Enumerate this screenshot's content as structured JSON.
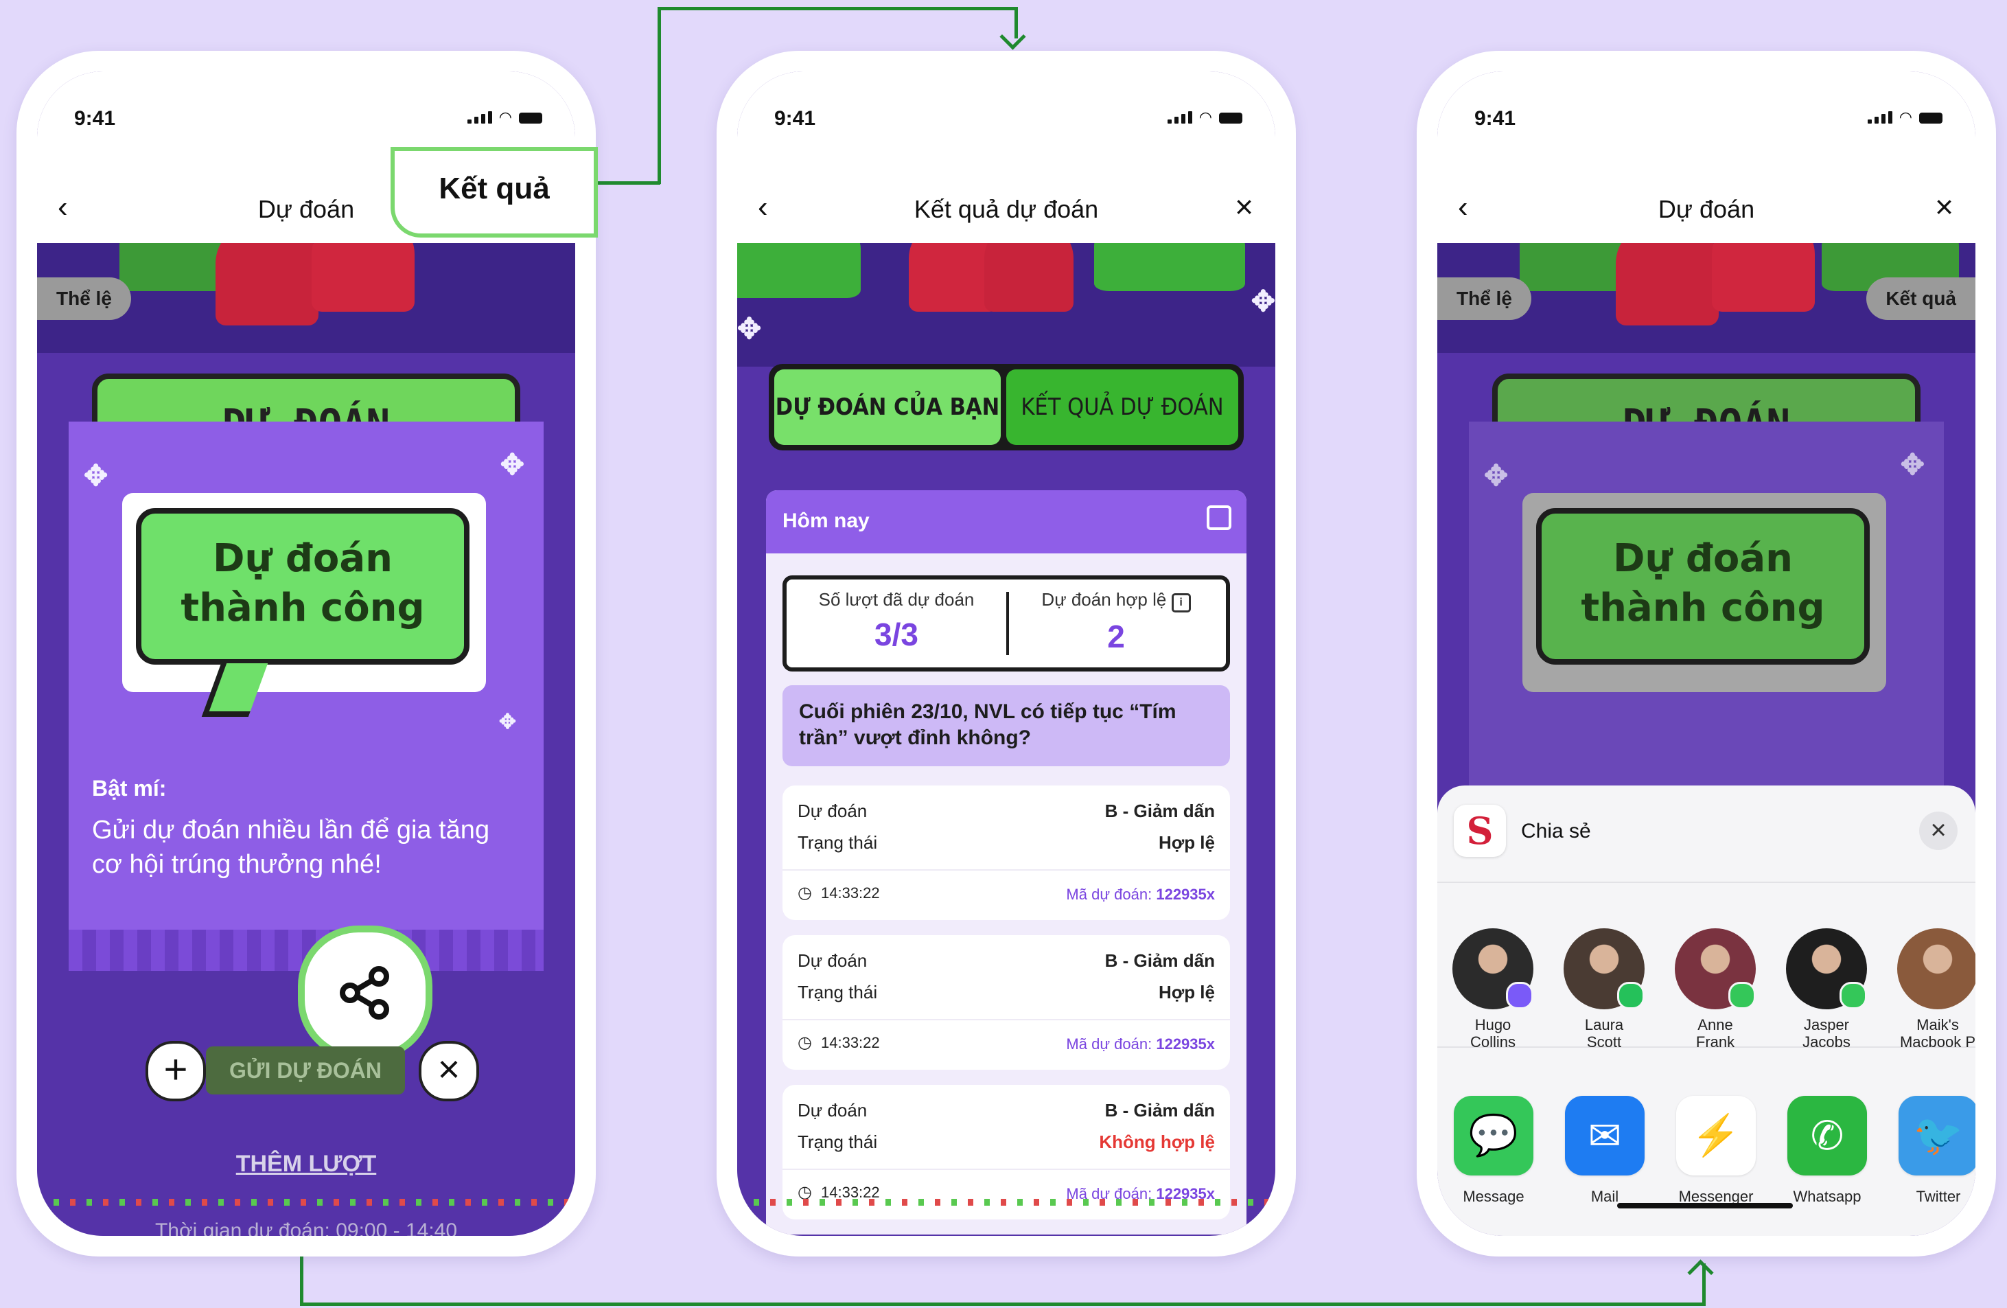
{
  "status": {
    "time": "9:41"
  },
  "phone1": {
    "nav_title": "Dự đoán",
    "rules_pill": "Thể lệ",
    "result_callout": "Kết quả",
    "result_pill_faded": "Kết quả",
    "banner_title": "DỰ ĐOÁN",
    "bubble_line1": "Dự đoán",
    "bubble_line2": "thành công",
    "tip_heading": "Bật mí:",
    "tip_body": "Gửi dự đoán nhiều lần để gia tăng cơ hội trúng thưởng nhé!",
    "send_button_faded": "GỬI DỰ ĐOÁN",
    "more_turns": "THÊM LƯỢT",
    "time_window": "Thời gian dự đoán: 09:00 - 14:40"
  },
  "phone2": {
    "nav_title": "Kết quả dự đoán",
    "tab_yours": "DỰ ĐOÁN CỦA BẠN",
    "tab_results": "KẾT QUẢ DỰ ĐOÁN",
    "day_label": "Hôm nay",
    "stat_count_label": "Số lượt đã dự đoán",
    "stat_count_value": "3/3",
    "stat_valid_label": "Dự đoán hợp lệ",
    "stat_valid_value": "2",
    "question": "Cuối phiên 23/10, NVL có tiếp tục “Tím trần” vượt đỉnh không?",
    "predictions": [
      {
        "label_pred": "Dự đoán",
        "value_pred": "B - Giảm dấn",
        "label_status": "Trạng thái",
        "value_status": "Hợp lệ",
        "status_valid": true,
        "time": "14:33:22",
        "code_label": "Mã dự đoán:",
        "code": "122935x"
      },
      {
        "label_pred": "Dự đoán",
        "value_pred": "B - Giảm dấn",
        "label_status": "Trạng thái",
        "value_status": "Hợp lệ",
        "status_valid": true,
        "time": "14:33:22",
        "code_label": "Mã dự đoán:",
        "code": "122935x"
      },
      {
        "label_pred": "Dự đoán",
        "value_pred": "B - Giảm dấn",
        "label_status": "Trạng thái",
        "value_status": "Không hợp lệ",
        "status_valid": false,
        "time": "14:33:22",
        "code_label": "Mã dự đoán:",
        "code": "122935x"
      }
    ]
  },
  "phone3": {
    "nav_title": "Dự đoán",
    "rules_pill": "Thể lệ",
    "result_pill": "Kết quả",
    "banner_title": "DỰ ĐOÁN",
    "bubble_line1": "Dự đoán",
    "bubble_line2": "thành công",
    "share_title": "Chia sẻ",
    "contacts": [
      {
        "name_line1": "Hugo",
        "name_line2": "Collins",
        "badge": "messenger"
      },
      {
        "name_line1": "Laura",
        "name_line2": "Scott",
        "badge": "whatsapp"
      },
      {
        "name_line1": "Anne",
        "name_line2": "Frank",
        "badge": "message"
      },
      {
        "name_line1": "Jasper",
        "name_line2": "Jacobs",
        "badge": "message"
      },
      {
        "name_line1": "Maik's",
        "name_line2": "Macbook P",
        "badge": ""
      }
    ],
    "apps": [
      {
        "label": "Message",
        "icon": "message-icon",
        "color": "#34c759"
      },
      {
        "label": "Mail",
        "icon": "mail-icon",
        "color": "#1e7cf2"
      },
      {
        "label": "Messenger",
        "icon": "messenger-icon",
        "color": "#ffffff"
      },
      {
        "label": "Whatsapp",
        "icon": "whatsapp-icon",
        "color": "#2bb741"
      },
      {
        "label": "Twitter",
        "icon": "twitter-icon",
        "color": "#3a9be8"
      }
    ]
  },
  "colors": {
    "background": "#e2d9fb",
    "screen_purple": "#5533a8",
    "accent_green": "#6fd65c",
    "flow_line": "#1f8a2e",
    "invalid_red": "#e53935",
    "code_purple": "#7a45e0"
  }
}
